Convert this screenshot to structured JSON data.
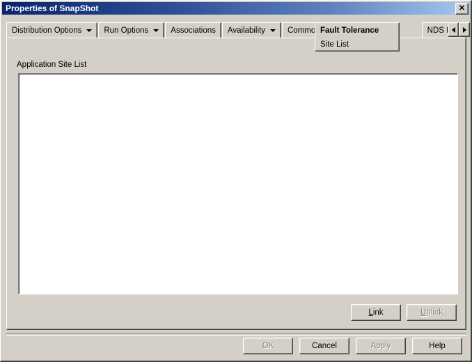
{
  "window": {
    "title": "Properties of SnapShot",
    "close_label": "✕",
    "titlebar_gradient_from": "#0a246a",
    "titlebar_gradient_to": "#a6caf0",
    "face_color": "#d4d0c8"
  },
  "tabs": [
    {
      "label": "Distribution Options",
      "has_dropdown": true,
      "active": false
    },
    {
      "label": "Run Options",
      "has_dropdown": true,
      "active": false
    },
    {
      "label": "Associations",
      "has_dropdown": false,
      "active": false
    },
    {
      "label": "Availability",
      "has_dropdown": true,
      "active": false
    },
    {
      "label": "Common",
      "has_dropdown": true,
      "active": false
    },
    {
      "label": "NDS Rights",
      "has_dropdown": false,
      "active": false,
      "clipped": true
    }
  ],
  "active_tab": {
    "label": "Fault Tolerance",
    "has_dropdown": true,
    "sub_label": "Site List"
  },
  "tab_scroll": {
    "left_icon": "arrow-left-icon",
    "right_icon": "arrow-right-icon"
  },
  "content": {
    "group_label": "Application Site List",
    "site_list_items": [],
    "buttons": [
      {
        "label": "Link",
        "mnemonic": "L",
        "enabled": true
      },
      {
        "label": "Unlink",
        "mnemonic": "U",
        "enabled": false
      }
    ]
  },
  "dialog_buttons": [
    {
      "label": "OK",
      "enabled": false
    },
    {
      "label": "Cancel",
      "enabled": true
    },
    {
      "label": "Apply",
      "enabled": false
    },
    {
      "label": "Help",
      "enabled": true
    }
  ]
}
